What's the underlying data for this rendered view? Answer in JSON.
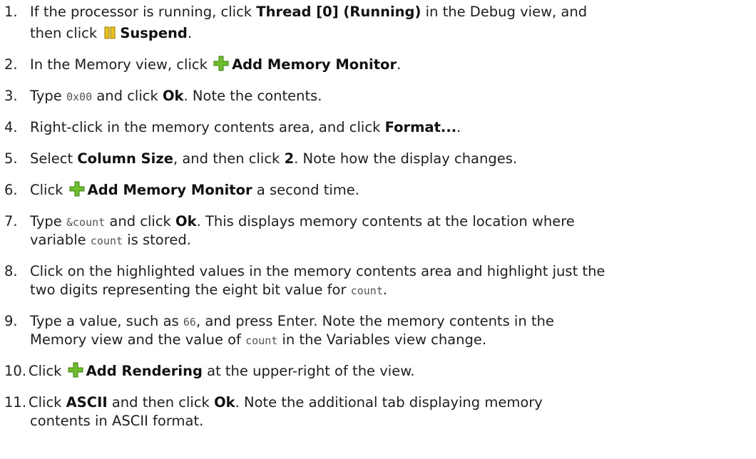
{
  "steps": [
    {
      "number": "1.",
      "a": "If the processor is running, click ",
      "b1": "Thread [0] (Running)",
      "c": " in the Debug view, and",
      "d": "then click ",
      "icon": "suspend-icon",
      "b2": "Suspend",
      "e": "."
    },
    {
      "number": "2.",
      "a": "In the Memory view, click ",
      "icon": "add-icon",
      "b1": "Add Memory Monitor",
      "e": "."
    },
    {
      "number": "3.",
      "a": "Type ",
      "code": "0x00",
      "c": " and click ",
      "b1": "Ok",
      "e": ". Note the contents."
    },
    {
      "number": "4.",
      "a": "Right-click in the memory contents area, and click ",
      "b1": "Format...",
      "e": "."
    },
    {
      "number": "5.",
      "a": "Select ",
      "b1": "Column Size",
      "c": ", and then click ",
      "b2": "2",
      "e": ". Note how the display changes."
    },
    {
      "number": "6.",
      "a": "Click ",
      "icon": "add-icon",
      "b1": "Add Memory Monitor",
      "e": " a second time."
    },
    {
      "number": "7.",
      "a": "Type ",
      "code": "&count",
      "c": " and click ",
      "b1": "Ok",
      "e": ". This displays memory contents at the location where",
      "f": "variable ",
      "code2": "count",
      "g": " is stored."
    },
    {
      "number": "8.",
      "a": "Click on the highlighted values in the memory contents area and highlight just the",
      "f": "two digits representing the eight bit value for ",
      "code2": "count",
      "g": "."
    },
    {
      "number": "9.",
      "a": "Type a value, such as ",
      "code": "66",
      "c": ", and press Enter.  Note the memory contents in the",
      "f": "Memory view and the value of ",
      "code2": "count",
      "g": " in the Variables view change."
    },
    {
      "number": "10.",
      "a": "Click ",
      "icon": "add-icon",
      "b1": "Add Rendering",
      "e": " at the upper-right of the view."
    },
    {
      "number": "11.",
      "a": "Click ",
      "b1": "ASCII",
      "c": " and then click ",
      "b2": "Ok",
      "e": ". Note the additional tab displaying memory",
      "f": "contents in ASCII format."
    }
  ],
  "colors": {
    "text": "#1e1e1e",
    "code": "#555555",
    "suspend_icon": "#e8c21a",
    "add_icon": "#6cbf2a"
  }
}
